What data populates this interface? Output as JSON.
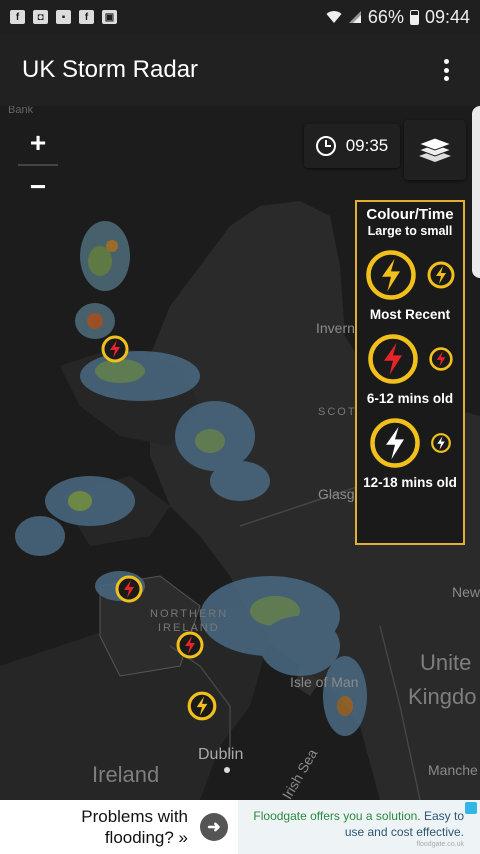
{
  "status_bar": {
    "icons": [
      "facebook-icon",
      "camera-icon",
      "news-icon",
      "facebook-icon",
      "bag-icon"
    ],
    "battery": "66%",
    "time": "09:44"
  },
  "app_bar": {
    "title": "UK Storm Radar",
    "menu_icon": "overflow-menu-icon"
  },
  "map": {
    "zoom_in_label": "+",
    "zoom_out_label": "−",
    "time_label": "09:35",
    "layers_icon": "layers-icon",
    "places": {
      "bank": "Bank",
      "inverness": "Invern",
      "scotland": "SCOT",
      "glasgow": "Glasg",
      "newcastle": "New",
      "northern_ireland_1": "NORTHERN",
      "northern_ireland_2": "IRELAND",
      "isle_of_man": "Isle of Man",
      "dublin": "Dublin",
      "irish_sea": "Irish Sea",
      "ireland": "Ireland",
      "united": "Unite",
      "kingdom": "Kingdo",
      "manchester": "Manche"
    }
  },
  "legend": {
    "title": "Colour/Time",
    "subtitle": "Large to small",
    "rows": [
      {
        "label": "Most Recent",
        "color": "#f2c01a",
        "bolt": "#f2c01a"
      },
      {
        "label": "6-12 mins old",
        "color": "#f2c01a",
        "bolt": "#e8242a"
      },
      {
        "label": "12-18 mins old",
        "color": "#f2c01a",
        "bolt": "#ffffff"
      }
    ]
  },
  "ad": {
    "headline": "Problems with flooding? »",
    "desc_1": "Floodgate offers you a solution.",
    "desc_2": " Easy to use and cost effective.",
    "url": "floodgate.co.uk"
  }
}
